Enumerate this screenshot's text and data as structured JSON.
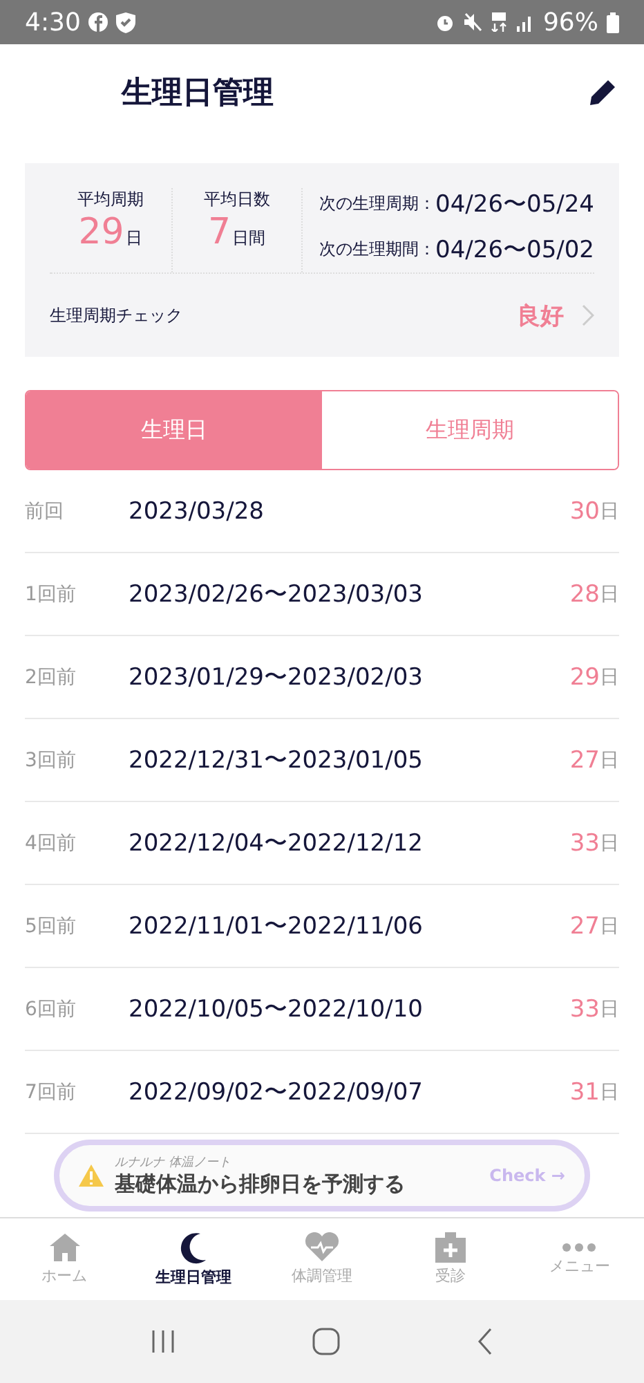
{
  "status_bar": {
    "time": "4:30",
    "battery": "96%"
  },
  "header": {
    "title": "生理日管理"
  },
  "summary": {
    "stats": [
      {
        "label": "平均周期",
        "value": "29",
        "unit": "日"
      },
      {
        "label": "平均日数",
        "value": "7",
        "unit": "日間"
      }
    ],
    "next": [
      {
        "label": "次の生理周期：",
        "value": "04/26〜05/24"
      },
      {
        "label": "次の生理期間：",
        "value": "04/26〜05/02"
      }
    ],
    "check": {
      "label": "生理周期チェック",
      "value": "良好"
    }
  },
  "tabs": [
    {
      "label": "生理日",
      "selected": true
    },
    {
      "label": "生理周期",
      "selected": false
    }
  ],
  "rows": [
    {
      "label": "前回",
      "dates": "2023/03/28",
      "days": "30",
      "unit": "日"
    },
    {
      "label": "1回前",
      "dates": "2023/02/26〜2023/03/03",
      "days": "28",
      "unit": "日"
    },
    {
      "label": "2回前",
      "dates": "2023/01/29〜2023/02/03",
      "days": "29",
      "unit": "日"
    },
    {
      "label": "3回前",
      "dates": "2022/12/31〜2023/01/05",
      "days": "27",
      "unit": "日"
    },
    {
      "label": "4回前",
      "dates": "2022/12/04〜2022/12/12",
      "days": "33",
      "unit": "日"
    },
    {
      "label": "5回前",
      "dates": "2022/11/01〜2022/11/06",
      "days": "27",
      "unit": "日"
    },
    {
      "label": "6回前",
      "dates": "2022/10/05〜2022/10/10",
      "days": "33",
      "unit": "日"
    },
    {
      "label": "7回前",
      "dates": "2022/09/02〜2022/09/07",
      "days": "31",
      "unit": "日"
    }
  ],
  "banner": {
    "caption": "ルナルナ 体温ノート",
    "text": "基礎体温から排卵日を予測する",
    "action": "Check →"
  },
  "nav": [
    {
      "label": "ホーム",
      "kind": "home",
      "selected": false
    },
    {
      "label": "生理日管理",
      "kind": "moon",
      "selected": true
    },
    {
      "label": "体調管理",
      "kind": "heart",
      "selected": false
    },
    {
      "label": "受診",
      "kind": "clinic",
      "selected": false
    },
    {
      "label": "メニュー",
      "kind": "dots",
      "selected": false
    }
  ]
}
